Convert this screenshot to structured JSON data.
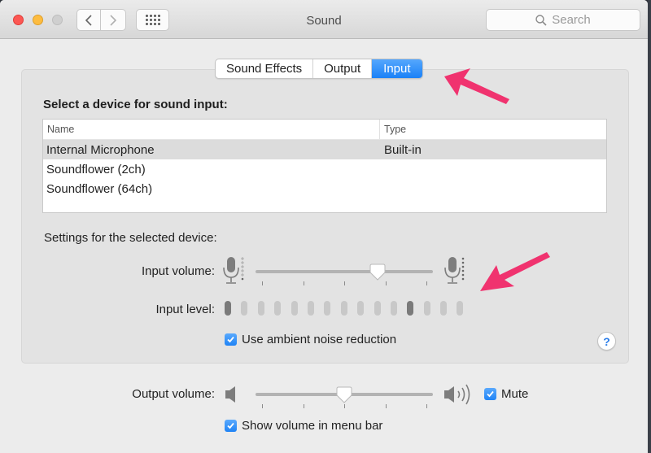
{
  "window": {
    "title": "Sound",
    "search_placeholder": "Search"
  },
  "tabs": [
    {
      "label": "Sound Effects",
      "active": false
    },
    {
      "label": "Output",
      "active": false
    },
    {
      "label": "Input",
      "active": true
    }
  ],
  "input": {
    "device_section_label": "Select a device for sound input:",
    "table": {
      "columns": [
        "Name",
        "Type"
      ],
      "rows": [
        {
          "name": "Internal Microphone",
          "type": "Built-in",
          "selected": true
        },
        {
          "name": "Soundflower (2ch)",
          "type": "",
          "selected": false
        },
        {
          "name": "Soundflower (64ch)",
          "type": "",
          "selected": false
        }
      ]
    },
    "settings_label": "Settings for the selected device:",
    "input_volume_label": "Input volume:",
    "input_volume_value": 0.69,
    "input_level_label": "Input level:",
    "input_level_segments": 15,
    "input_level_lit": [
      0,
      11
    ],
    "ambient_noise_label": "Use ambient noise reduction",
    "ambient_noise_checked": true,
    "help_label": "?"
  },
  "output": {
    "volume_label": "Output volume:",
    "volume_value": 0.5,
    "mute_label": "Mute",
    "mute_checked": true,
    "show_menu_bar_label": "Show volume in menu bar",
    "show_menu_bar_checked": true
  },
  "annotations": {
    "arrow_color": "#f0336f"
  },
  "colors": {
    "accent": "#1a81f7",
    "close": "#fc5753",
    "minimize": "#fdbc40"
  }
}
